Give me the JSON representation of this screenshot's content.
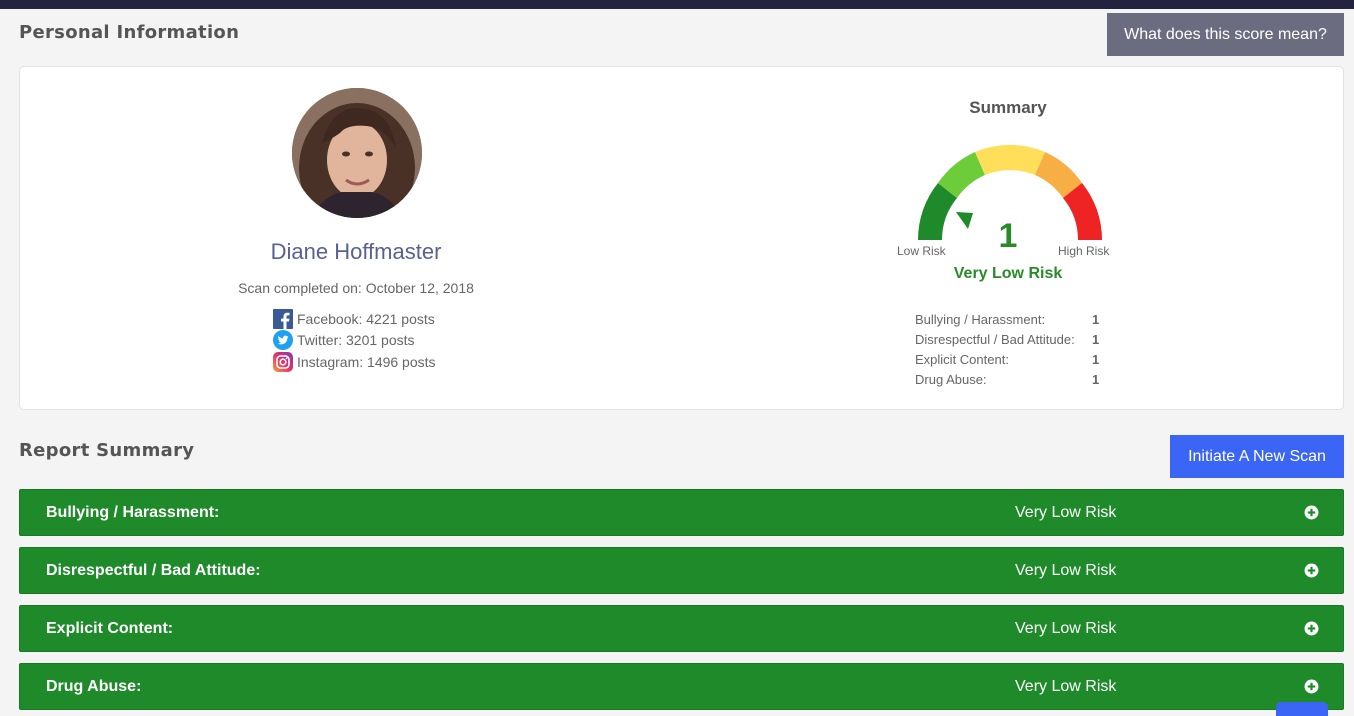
{
  "header": {
    "personal_title": "Personal Information",
    "score_button": "What does this score mean?"
  },
  "profile": {
    "name": "Diane Hoffmaster",
    "scan_completed": "Scan completed on: October 12, 2018",
    "socials": [
      {
        "icon": "facebook-icon",
        "label": "Facebook: 4221 posts"
      },
      {
        "icon": "twitter-icon",
        "label": "Twitter: 3201 posts"
      },
      {
        "icon": "instagram-icon",
        "label": "Instagram: 1496 posts"
      }
    ]
  },
  "summary": {
    "title": "Summary",
    "score": "1",
    "low_label": "Low Risk",
    "high_label": "High Risk",
    "risk_level": "Very Low Risk",
    "categories": [
      {
        "label": "Bullying / Harassment:",
        "value": "1"
      },
      {
        "label": "Disrespectful / Bad Attitude:",
        "value": "1"
      },
      {
        "label": "Explicit Content:",
        "value": "1"
      },
      {
        "label": "Drug Abuse:",
        "value": "1"
      }
    ]
  },
  "report": {
    "title": "Report Summary",
    "new_scan_button": "Initiate A New Scan",
    "rows": [
      {
        "label": "Bullying / Harassment:",
        "risk": "Very Low Risk"
      },
      {
        "label": "Disrespectful / Bad Attitude:",
        "risk": "Very Low Risk"
      },
      {
        "label": "Explicit Content:",
        "risk": "Very Low Risk"
      },
      {
        "label": "Drug Abuse:",
        "risk": "Very Low Risk"
      }
    ]
  },
  "colors": {
    "accent_green": "#1f8a2a",
    "button_blue": "#3b66f5",
    "button_gray": "#6c6c80",
    "topbar": "#23233f"
  }
}
